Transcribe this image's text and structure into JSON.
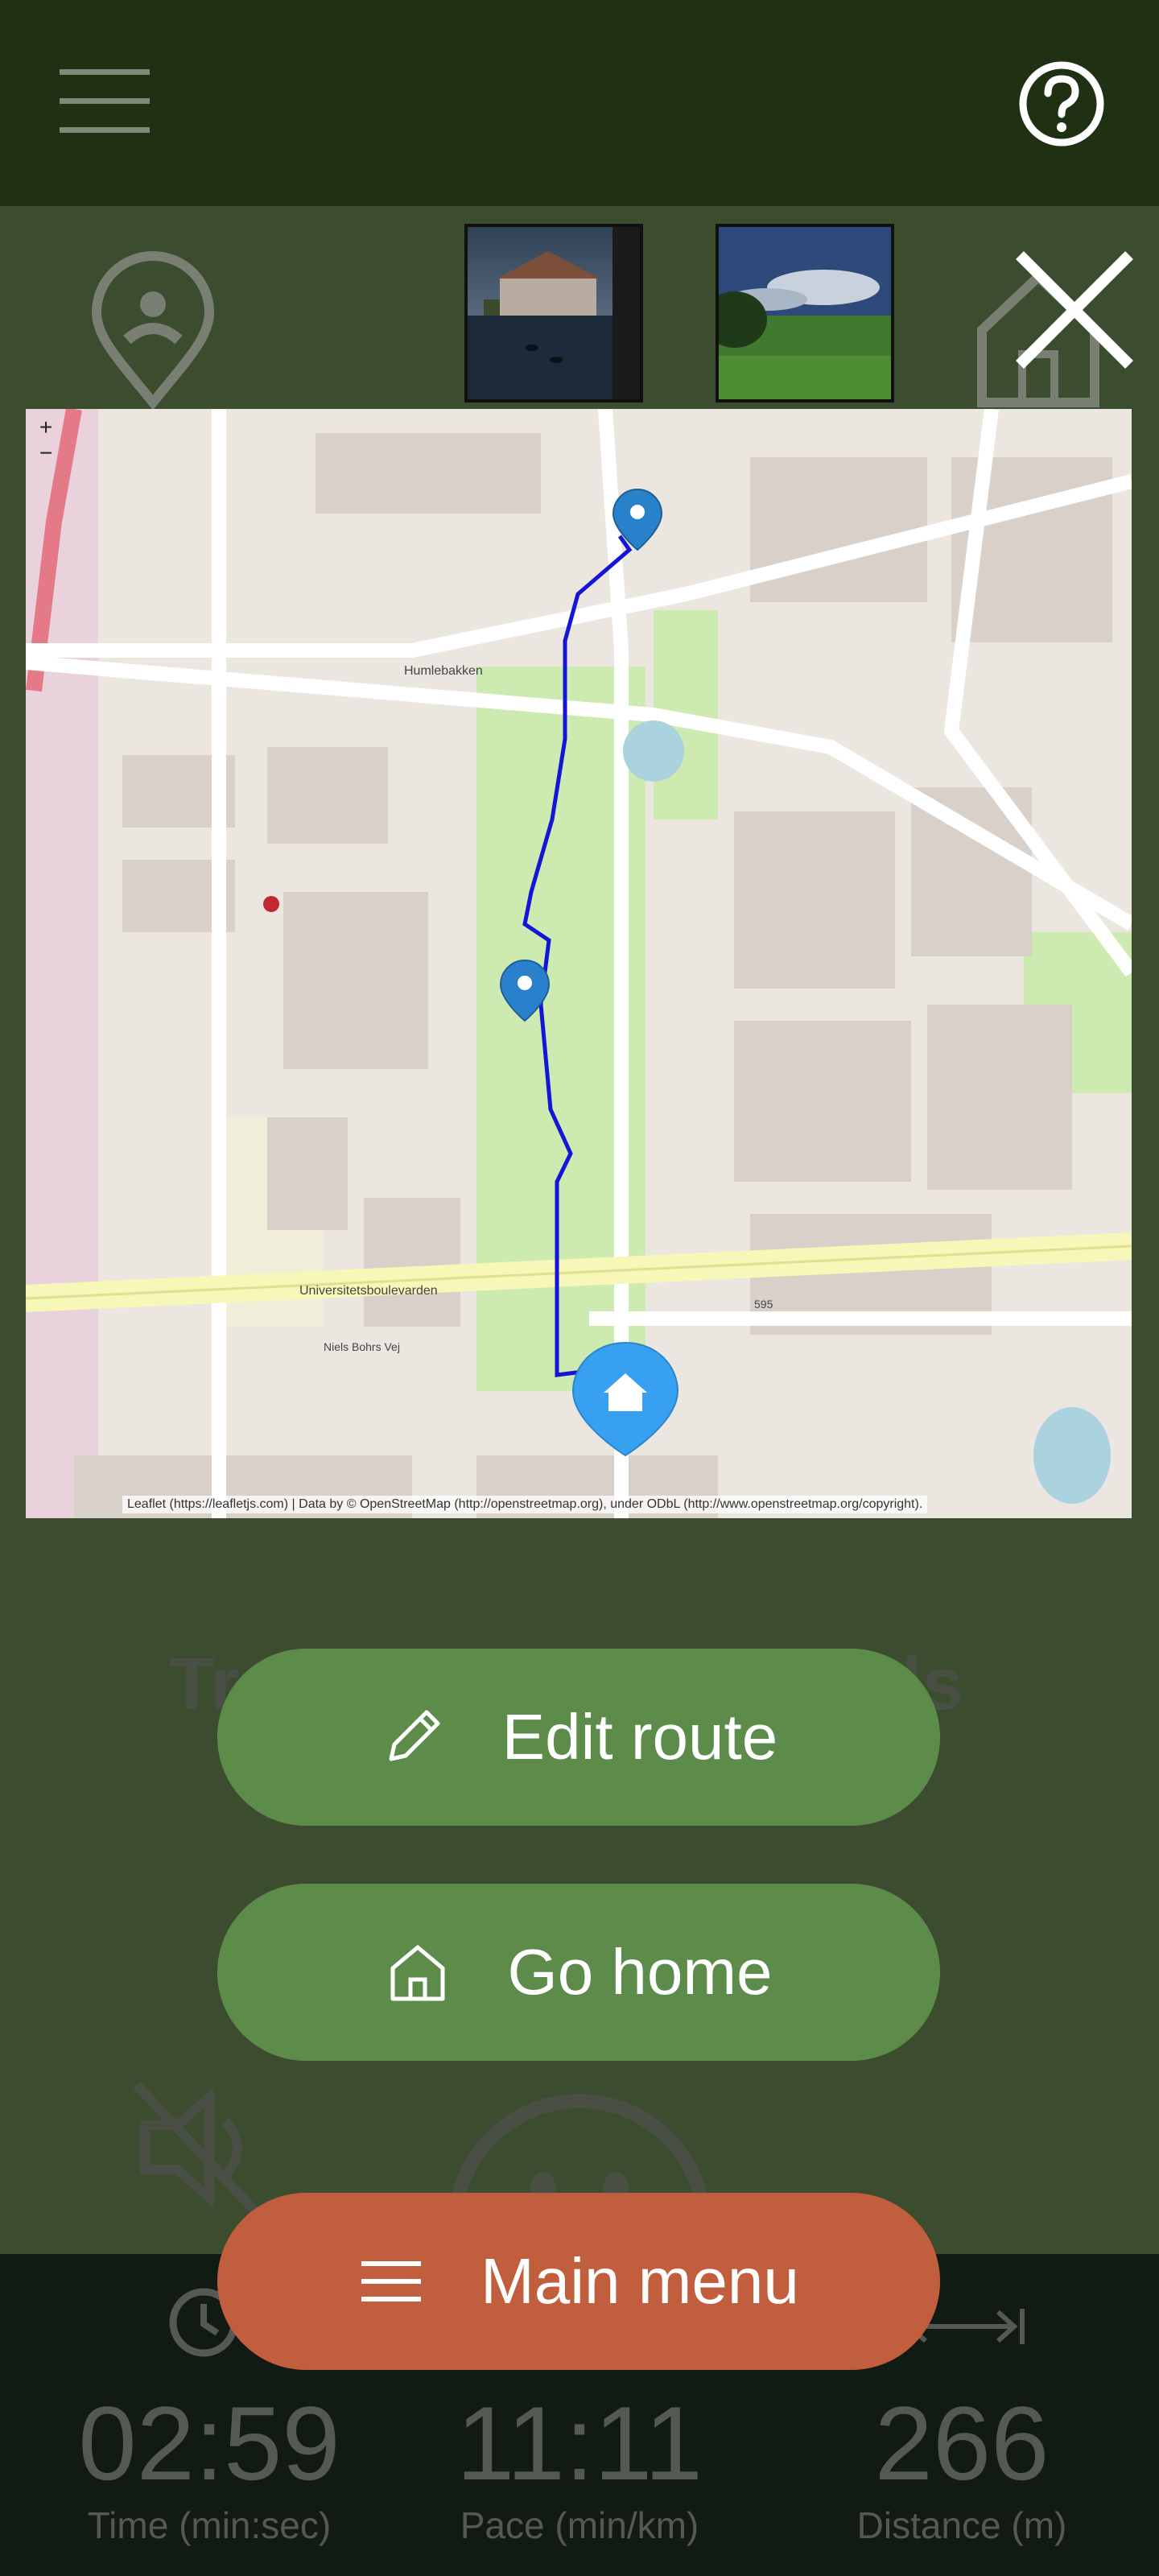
{
  "app": {
    "menu_icon": "hamburger-icon",
    "help_icon": "help-circle-icon"
  },
  "background_screen": {
    "title_left": "Tr",
    "title_right": "ls",
    "sound_icon": "speaker-muted-icon",
    "face_icon": "smiley-face-icon"
  },
  "stats": [
    {
      "value": "02:59",
      "label": "Time (min:sec)",
      "icon": "clock-icon"
    },
    {
      "value": "11:11",
      "label": "Pace (min/km)",
      "icon": "pace-icon"
    },
    {
      "value": "266",
      "label": "Distance (m)",
      "icon": "distance-arrow-icon"
    }
  ],
  "route_popup": {
    "close_icon": "close-icon",
    "person_pin_icon": "person-pin-icon",
    "home_outline_icon": "home-outline-icon",
    "photos": [
      "lake-manor-photo",
      "green-field-photo"
    ],
    "map": {
      "attribution": "Leaflet (https://leafletjs.com) | Data by © OpenStreetMap (http://openstreetmap.org), under ODbL (http://www.openstreetmap.org/copyright).",
      "zoom_in": "+",
      "zoom_out": "−",
      "road_labels": [
        "Universitetsboulevarden",
        "Humlebakken",
        "595",
        "Niels Bohrs Vej"
      ],
      "route_color": "#1515d8"
    }
  },
  "actions": {
    "edit_route": "Edit route",
    "go_home": "Go home",
    "main_menu": "Main menu"
  },
  "colors": {
    "top_bar": "#1f3013",
    "accent_green": "#5d8c4a",
    "accent_orange": "#c15e3e",
    "bottom_bar": "#0d1a12"
  }
}
